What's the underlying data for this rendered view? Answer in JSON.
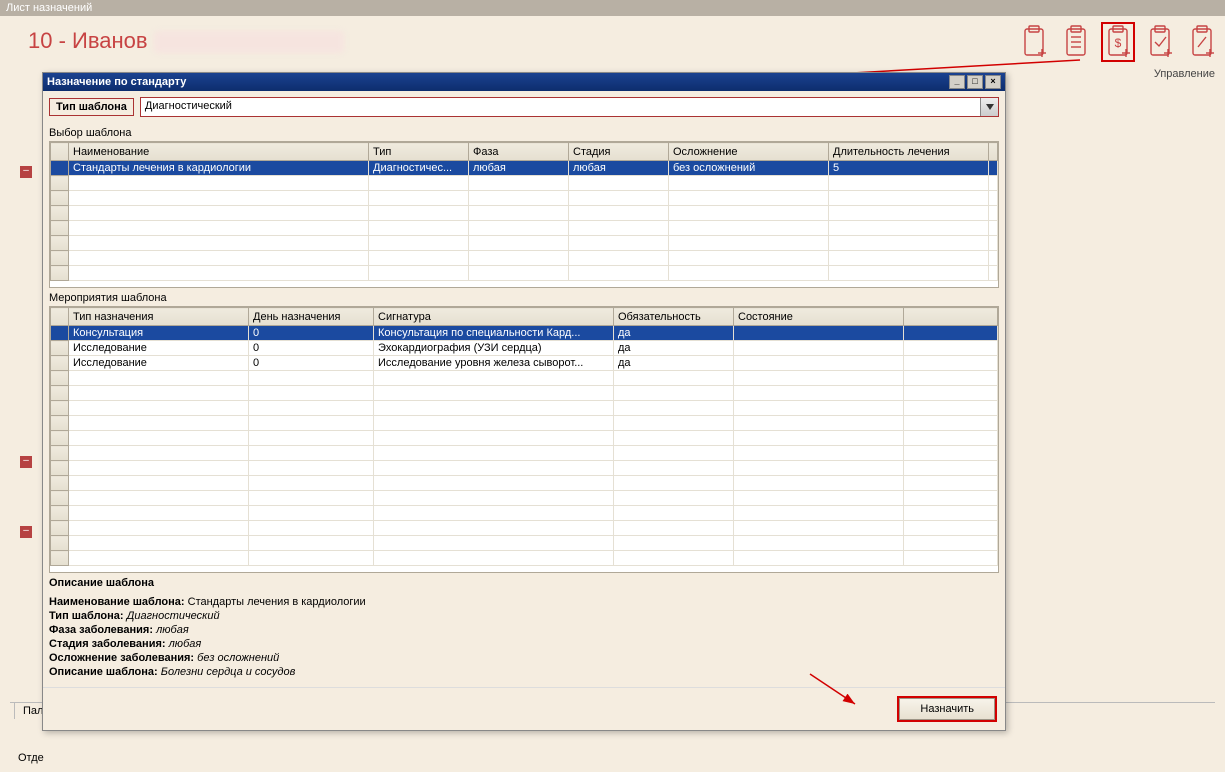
{
  "app": {
    "title": "Лист назначений"
  },
  "patient": {
    "id_and_name": "10 - Иванов"
  },
  "ribbon": {
    "manage_label": "Управление"
  },
  "background": {
    "tab_label": "Пала",
    "dept_label": "Отде"
  },
  "dialog": {
    "title": "Назначение по стандарту",
    "win_min": "_",
    "win_max": "□",
    "win_close": "×",
    "type_label": "Тип шаблона",
    "type_value": "Диагностический",
    "section1": "Выбор шаблона",
    "section2": "Мероприятия шаблона",
    "section3": "Описание шаблона",
    "table1": {
      "headers": [
        "",
        "Наименование",
        "Тип",
        "Фаза",
        "Стадия",
        "Осложнение",
        "Длительность лечения",
        ""
      ],
      "rows": [
        {
          "sel": true,
          "cells": [
            "Стандарты лечения в кардиологии",
            "Диагностичес...",
            "любая",
            "любая",
            "без осложнений",
            "5"
          ]
        }
      ]
    },
    "table2": {
      "headers": [
        "",
        "Тип назначения",
        "День назначения",
        "Сигнатура",
        "Обязательность",
        "Состояние",
        ""
      ],
      "rows": [
        {
          "sel": true,
          "cells": [
            "Консультация",
            "0",
            "Консультация по специальности Кард...",
            "да",
            ""
          ]
        },
        {
          "sel": false,
          "cells": [
            "Исследование",
            "0",
            "Эхокардиография (УЗИ сердца)",
            "да",
            ""
          ]
        },
        {
          "sel": false,
          "cells": [
            "Исследование",
            "0",
            "Исследование уровня железа сыворот...",
            "да",
            ""
          ]
        }
      ]
    },
    "desc": {
      "l1_label": "Наименование шаблона:",
      "l1_val": "Стандарты лечения в кардиологии",
      "l2_label": "Тип шаблона:",
      "l2_val": "Диагностический",
      "l3_label": "Фаза заболевания:",
      "l3_val": "любая",
      "l4_label": "Стадия заболевания:",
      "l4_val": "любая",
      "l5_label": "Осложнение заболевания:",
      "l5_val": "без осложнений",
      "l6_label": "Описание шаблона:",
      "l6_val": "Болезни сердца и сосудов"
    },
    "assign_button": "Назначить"
  }
}
